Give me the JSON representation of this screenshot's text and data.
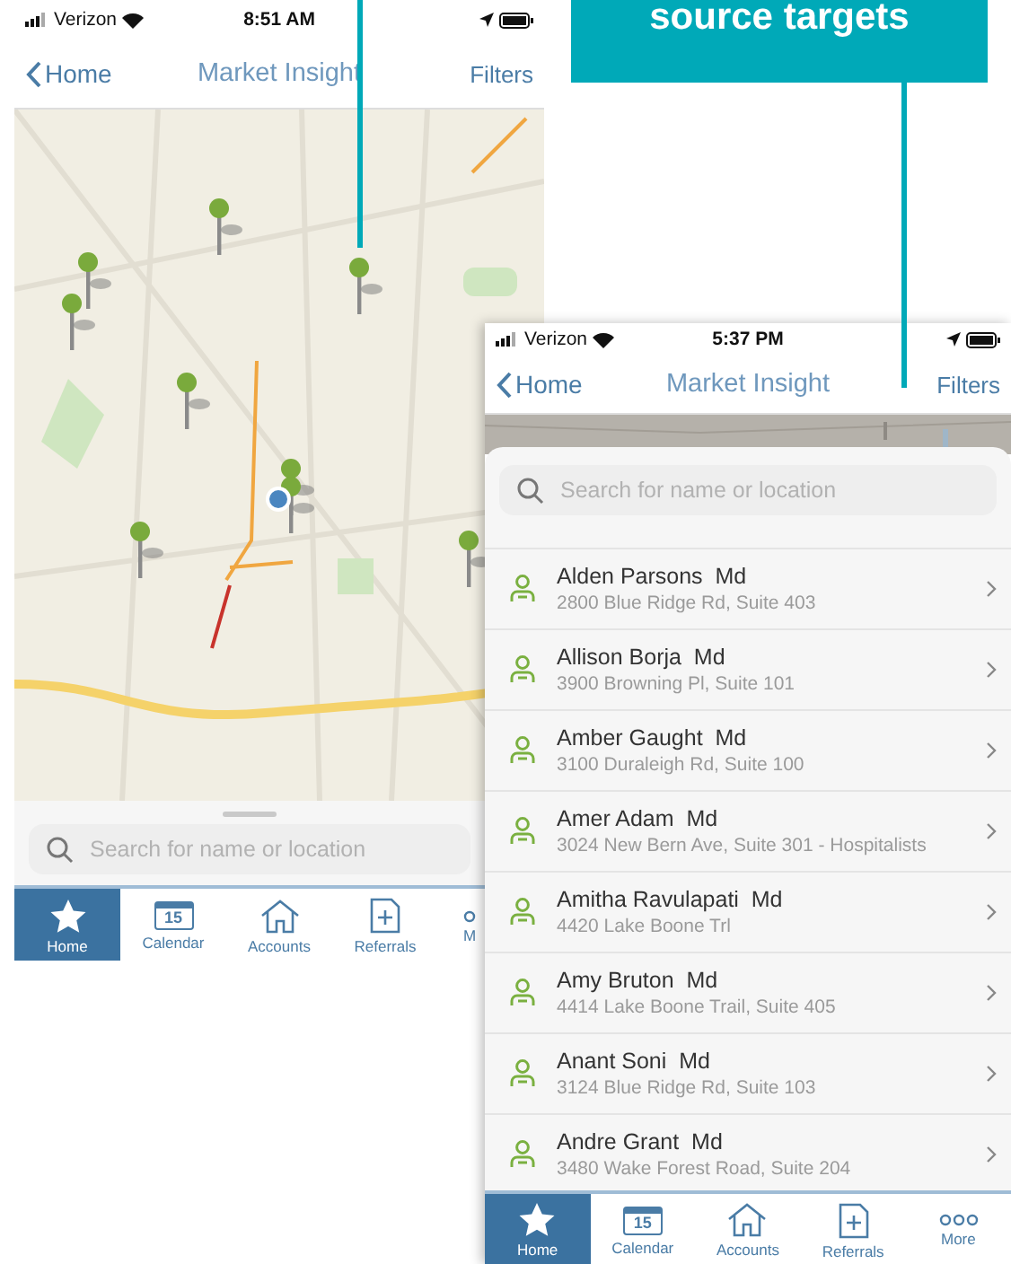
{
  "callout": {
    "text": "source targets"
  },
  "phones": [
    {
      "kind": "map",
      "status": {
        "carrier": "Verizon",
        "time": "8:51 AM"
      },
      "nav": {
        "back": "Home",
        "title": "Market Insight",
        "action": "Filters"
      },
      "search": {
        "placeholder": "Search for name or location"
      },
      "tabs": [
        {
          "kind": "star",
          "label": "Home",
          "selected": true
        },
        {
          "kind": "calendar",
          "label": "Calendar",
          "icon_text": "15",
          "selected": false
        },
        {
          "kind": "house",
          "label": "Accounts",
          "selected": false
        },
        {
          "kind": "document",
          "label": "Referrals",
          "selected": false
        },
        {
          "kind": "dots",
          "label": "M",
          "selected": false
        }
      ]
    },
    {
      "kind": "list",
      "status": {
        "carrier": "Verizon",
        "time": "5:37 PM"
      },
      "nav": {
        "back": "Home",
        "title": "Market Insight",
        "action": "Filters"
      },
      "search": {
        "placeholder": "Search for name or location"
      },
      "rows": [
        {
          "name": "Alden Parsons  Md",
          "address": "2800 Blue Ridge Rd, Suite 403"
        },
        {
          "name": "Allison Borja  Md",
          "address": "3900 Browning Pl, Suite 101"
        },
        {
          "name": "Amber Gaught  Md",
          "address": "3100 Duraleigh Rd, Suite 100"
        },
        {
          "name": "Amer Adam  Md",
          "address": "3024 New Bern Ave, Suite 301 - Hospitalists"
        },
        {
          "name": "Amitha Ravulapati  Md",
          "address": "4420 Lake Boone Trl"
        },
        {
          "name": "Amy Bruton  Md",
          "address": "4414 Lake Boone Trail, Suite 405"
        },
        {
          "name": "Anant Soni  Md",
          "address": "3124 Blue Ridge Rd, Suite 103"
        },
        {
          "name": "Andre Grant  Md",
          "address": "3480 Wake Forest Road, Suite 204"
        }
      ],
      "tabs": [
        {
          "kind": "star",
          "label": "Home",
          "selected": true
        },
        {
          "kind": "calendar",
          "label": "Calendar",
          "icon_text": "15",
          "selected": false
        },
        {
          "kind": "house",
          "label": "Accounts",
          "selected": false
        },
        {
          "kind": "document",
          "label": "Referrals",
          "selected": false
        },
        {
          "kind": "dots",
          "label": "More",
          "selected": false
        }
      ]
    }
  ]
}
